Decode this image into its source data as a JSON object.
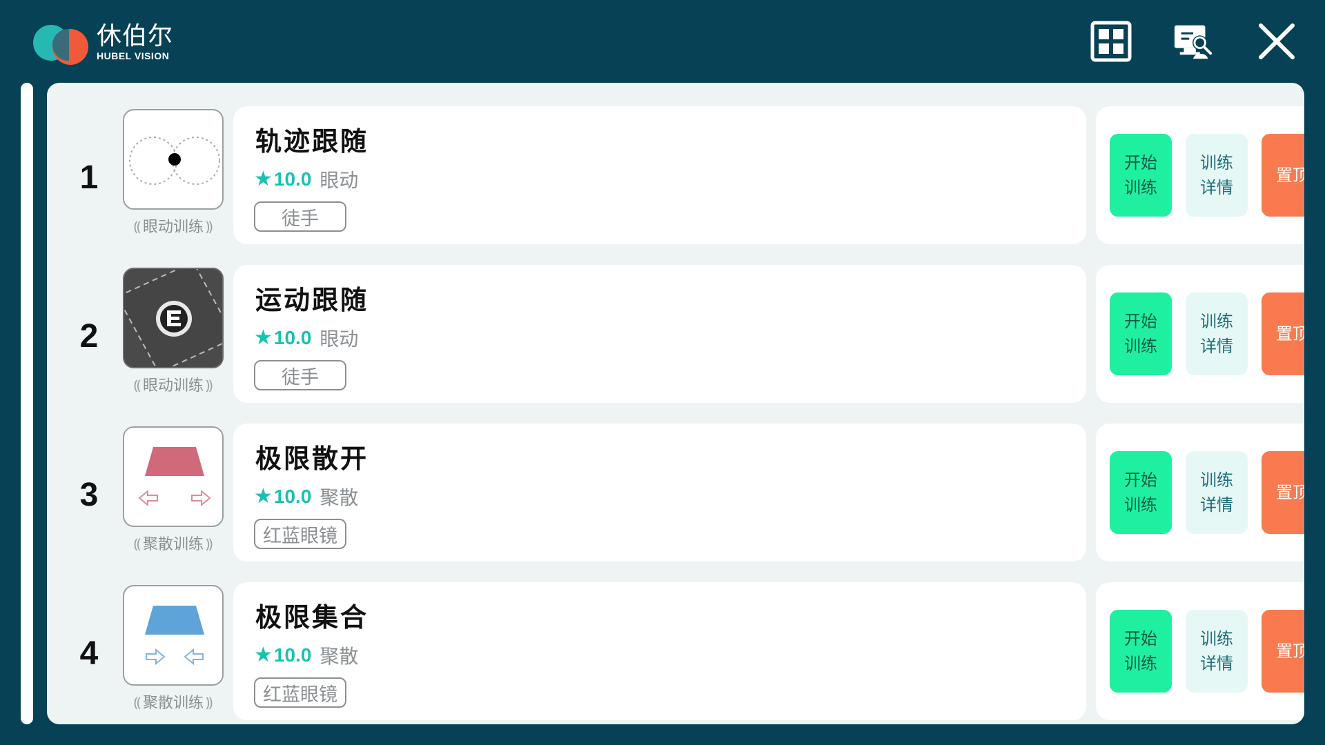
{
  "header": {
    "logo_cn": "休伯尔",
    "logo_en": "HUBEL VISION",
    "icons": [
      "grid-icon",
      "monitor-search-icon",
      "close-icon"
    ]
  },
  "colors": {
    "background": "#064155",
    "panel": "#eef3f3",
    "accent_teal": "#18c2b0",
    "start_button": "#1ff0a0",
    "detail_button": "#e6f8f6",
    "top_button": "#fa7a4f"
  },
  "items": [
    {
      "rank": "1",
      "title": "轨迹跟随",
      "star": "★",
      "score": "10.0",
      "category": "眼动",
      "tag": "徒手",
      "thumb_label": "眼动训练",
      "thumb_icon": "infinity-track-icon",
      "btn_start_1": "开始",
      "btn_start_2": "训练",
      "btn_detail_1": "训练",
      "btn_detail_2": "详情",
      "btn_top": "置顶"
    },
    {
      "rank": "2",
      "title": "运动跟随",
      "star": "★",
      "score": "10.0",
      "category": "眼动",
      "tag": "徒手",
      "thumb_label": "眼动训练",
      "thumb_icon": "e-chart-rotating-icon",
      "btn_start_1": "开始",
      "btn_start_2": "训练",
      "btn_detail_1": "训练",
      "btn_detail_2": "详情",
      "btn_top": "置顶"
    },
    {
      "rank": "3",
      "title": "极限散开",
      "star": "★",
      "score": "10.0",
      "category": "聚散",
      "tag": "红蓝眼镜",
      "thumb_label": "聚散训练",
      "thumb_icon": "red-trapezoid-diverge-icon",
      "btn_start_1": "开始",
      "btn_start_2": "训练",
      "btn_detail_1": "训练",
      "btn_detail_2": "详情",
      "btn_top": "置顶"
    },
    {
      "rank": "4",
      "title": "极限集合",
      "star": "★",
      "score": "10.0",
      "category": "聚散",
      "tag": "红蓝眼镜",
      "thumb_label": "聚散训练",
      "thumb_icon": "blue-trapezoid-converge-icon",
      "btn_start_1": "开始",
      "btn_start_2": "训练",
      "btn_detail_1": "训练",
      "btn_detail_2": "详情",
      "btn_top": "置顶"
    }
  ]
}
